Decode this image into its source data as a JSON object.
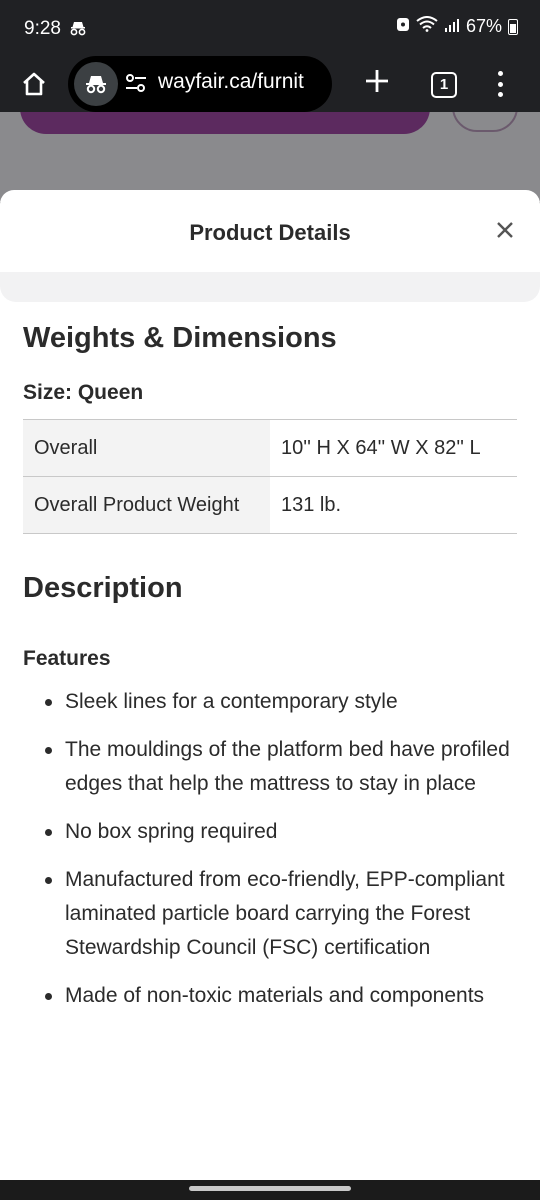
{
  "status_bar": {
    "time": "9:28",
    "battery": "67%"
  },
  "browser": {
    "url": "wayfair.ca/furnit",
    "tab_count": "1"
  },
  "sheet": {
    "title": "Product Details",
    "sections": {
      "weights_dimensions": {
        "heading": "Weights & Dimensions",
        "size_label": "Size: Queen",
        "rows": [
          {
            "label": "Overall",
            "value": "10'' H X 64'' W X 82'' L"
          },
          {
            "label": "Overall Product Weight",
            "value": "131 lb."
          }
        ]
      },
      "description": {
        "heading": "Description",
        "features_label": "Features",
        "features": [
          "Sleek lines for a contemporary style",
          "The mouldings of the platform bed have profiled edges that help the mattress to stay in place",
          "No box spring required",
          "Manufactured from eco-friendly, EPP-compliant laminated particle board carrying the Forest Stewardship Council (FSC) certification",
          "Made of non-toxic materials and components"
        ]
      }
    }
  }
}
